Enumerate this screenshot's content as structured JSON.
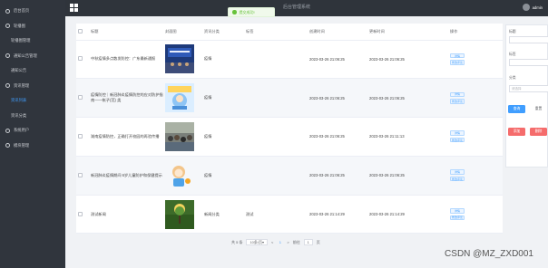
{
  "sidebar": {
    "items": [
      {
        "label": "后台首页",
        "type": "parent"
      },
      {
        "label": "轮播图",
        "type": "parent"
      },
      {
        "label": "轮播图管理",
        "type": "sub"
      },
      {
        "label": "通知公告管理",
        "type": "parent"
      },
      {
        "label": "通知公告",
        "type": "sub"
      },
      {
        "label": "资讯管理",
        "type": "parent"
      },
      {
        "label": "资讯列表",
        "type": "sub-active"
      },
      {
        "label": "资讯分类",
        "type": "sub"
      },
      {
        "label": "系统用户",
        "type": "parent"
      },
      {
        "label": "模块管理",
        "type": "parent"
      }
    ]
  },
  "header": {
    "title": "后台管理系统",
    "user": "admin"
  },
  "toast": {
    "message": "提交成功!",
    "color": "#67c23a"
  },
  "table": {
    "headers": [
      "",
      "标题",
      "封面图",
      "资讯分类",
      "标签",
      "创建时间",
      "更新时间",
      "操作"
    ],
    "rows": [
      {
        "title": "中秋疫情多点散发防控：广东最新通报",
        "category": "疫情",
        "tag": "",
        "created": "2023-03-26 21:06:25",
        "updated": "2023-03-26 21:06:25",
        "thumb": "photo-blue"
      },
      {
        "title": "疫情防控｜新冠肺炎疫情防控的应对防护指南——帐子(范) 类",
        "category": "疫情",
        "tag": "",
        "created": "2023-03-26 21:06:25",
        "updated": "2023-03-26 21:06:25",
        "thumb": "illustration"
      },
      {
        "title": "湖南疫情防控，正确打开校园的再验传播",
        "category": "疫情",
        "tag": "",
        "created": "2023-03-26 21:06:25",
        "updated": "2023-03-26 21:11:13",
        "thumb": "photo-crowd"
      },
      {
        "title": "新冠肺炎疫情期间 6岁儿童防护和保健提示",
        "category": "疫情",
        "tag": "",
        "created": "2023-03-26 21:06:25",
        "updated": "2023-03-26 21:06:25",
        "thumb": "cartoon"
      },
      {
        "title": "测试新闻",
        "category": "新闻分类",
        "tag": "测试",
        "created": "2023-03-26 21:14:29",
        "updated": "2023-03-26 21:14:29",
        "thumb": "photo-tree"
      }
    ],
    "actions": {
      "detail": "详情",
      "edit": "修改评论"
    }
  },
  "pager": {
    "total": "共 5 条",
    "size": "10条/页",
    "prev": "<",
    "page": "1",
    "next": ">",
    "goto": "前往",
    "page_input": "1",
    "suffix": "页"
  },
  "panel": {
    "title_label": "标题",
    "tag_label": "标签",
    "category_label": "分类",
    "category_placeholder": "请选择",
    "search": "查询",
    "reset": "重置",
    "add": "添加",
    "delete": "删除"
  },
  "watermark": "CSDN @MZ_ZXD001"
}
